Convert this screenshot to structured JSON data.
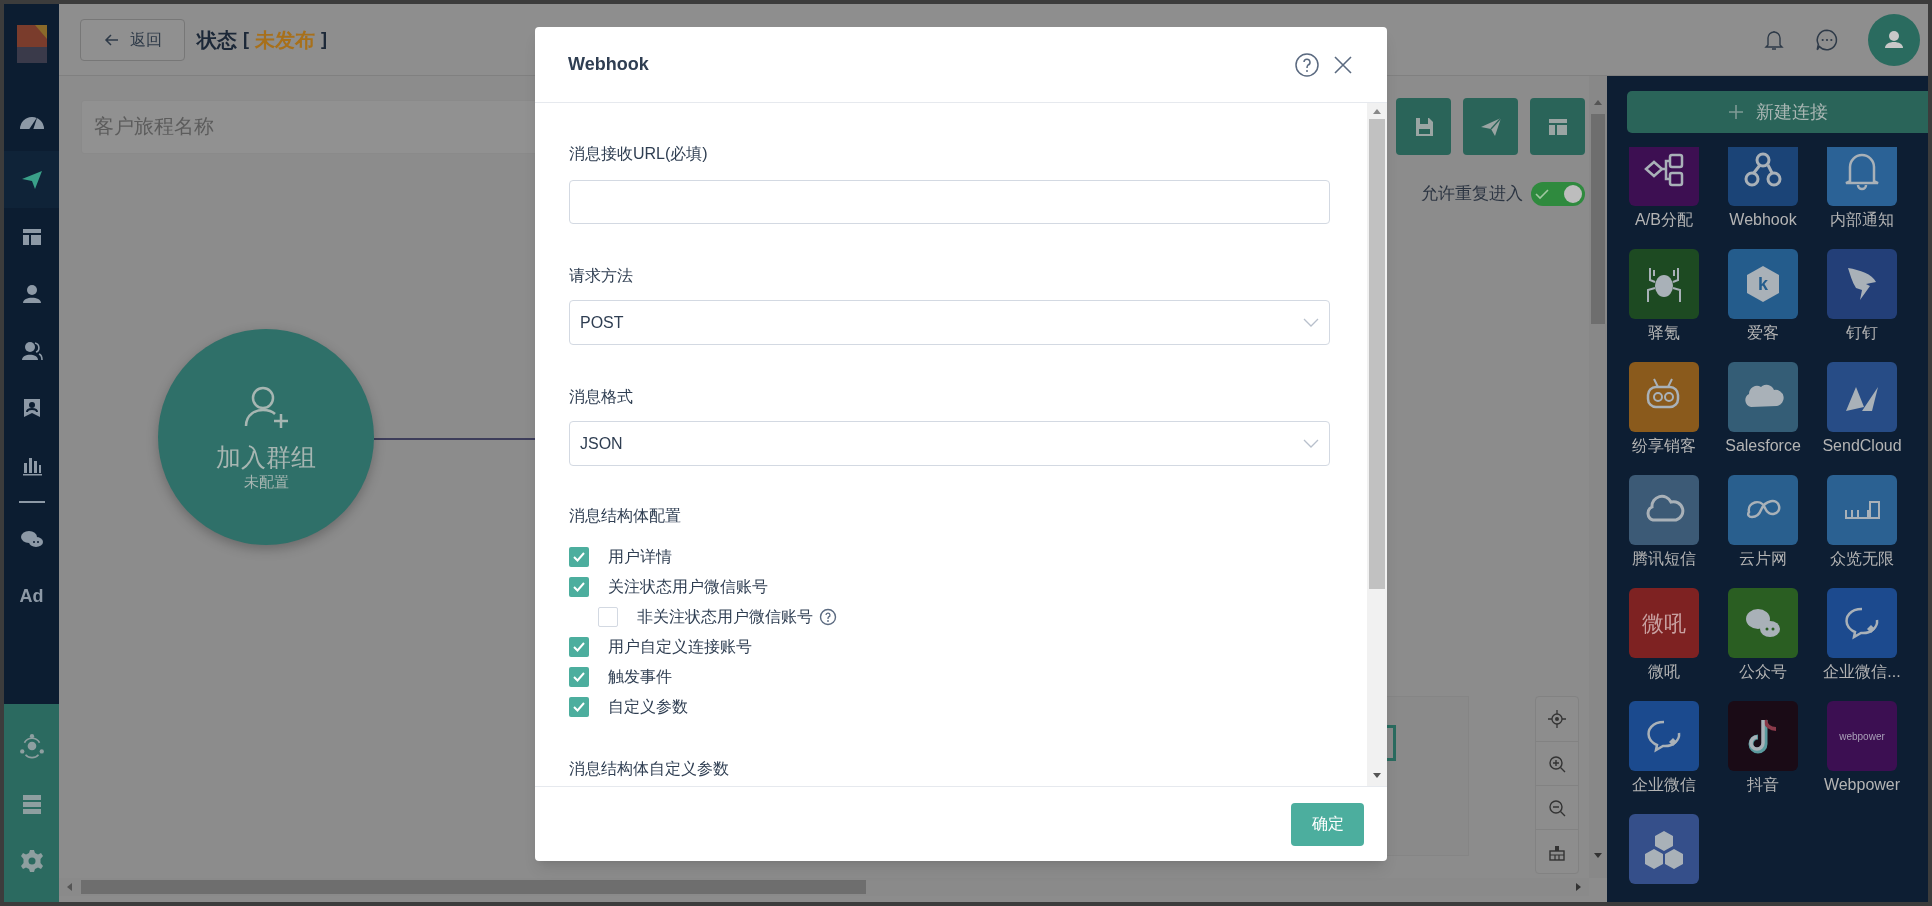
{
  "sidebar": {
    "items": [
      {
        "selected": false
      },
      {
        "selected": true
      },
      {
        "selected": false
      },
      {
        "selected": false
      },
      {
        "selected": false
      },
      {
        "selected": false
      },
      {
        "selected": false
      },
      {
        "selected": false
      },
      {
        "label": "Ad",
        "selected": false
      }
    ]
  },
  "header": {
    "back_button": "返回",
    "title": "状态",
    "status": {
      "open": "[",
      "label": "未发布",
      "close": "]"
    }
  },
  "canvas": {
    "name_placeholder": "客户旅程名称",
    "repeat_entry": {
      "label": "允许重复进入",
      "on": true
    },
    "node": {
      "title": "加入群组",
      "subtitle": "未配置"
    }
  },
  "panel": {
    "new_button": "新建连接",
    "connectors": [
      {
        "label": "A/B分配",
        "color": "#3d0f52"
      },
      {
        "label": "Webhook",
        "color": "#1b4477"
      },
      {
        "label": "内部通知",
        "color": "#2b6296"
      },
      {
        "label": "驿氪",
        "color": "#1d4a22"
      },
      {
        "label": "爱客",
        "color": "#245c8c",
        "logo_text": "k"
      },
      {
        "label": "钉钉",
        "color": "#233f78"
      },
      {
        "label": "纷享销客",
        "color": "#8a5a1c"
      },
      {
        "label": "Salesforce",
        "color": "#345d76"
      },
      {
        "label": "SendCloud",
        "color": "#274c86"
      },
      {
        "label": "腾讯短信",
        "color": "#3c5a76"
      },
      {
        "label": "云片网",
        "color": "#295f8e"
      },
      {
        "label": "众览无限",
        "color": "#2b6192"
      },
      {
        "label": "微吼",
        "color": "#7e2222",
        "logo_text": "微吼"
      },
      {
        "label": "公众号",
        "color": "#2a5e22"
      },
      {
        "label": "企业微信...",
        "color": "#1c4a8e"
      },
      {
        "label": "企业微信",
        "color": "#1b4a8e"
      },
      {
        "label": "抖音",
        "color": "#1a0b16"
      },
      {
        "label": "Webpower",
        "color": "#3c0f52",
        "logo_text": "webpower"
      },
      {
        "color": "#354f8a"
      }
    ]
  },
  "modal": {
    "title": "Webhook",
    "url": {
      "label": "消息接收URL(必填)"
    },
    "method": {
      "label": "请求方法",
      "value": "POST"
    },
    "format": {
      "label": "消息格式",
      "value": "JSON"
    },
    "struct_config": {
      "label": "消息结构体配置",
      "options": [
        {
          "label": "用户详情",
          "checked": true
        },
        {
          "label": "关注状态用户微信账号",
          "checked": true,
          "children": [
            {
              "label": "非关注状态用户微信账号",
              "checked": false,
              "help": true
            }
          ]
        },
        {
          "label": "用户自定义连接账号",
          "checked": true
        },
        {
          "label": "触发事件",
          "checked": true
        },
        {
          "label": "自定义参数",
          "checked": true
        }
      ]
    },
    "custom_params_label": "消息结构体自定义参数",
    "confirm_button": "确定"
  }
}
